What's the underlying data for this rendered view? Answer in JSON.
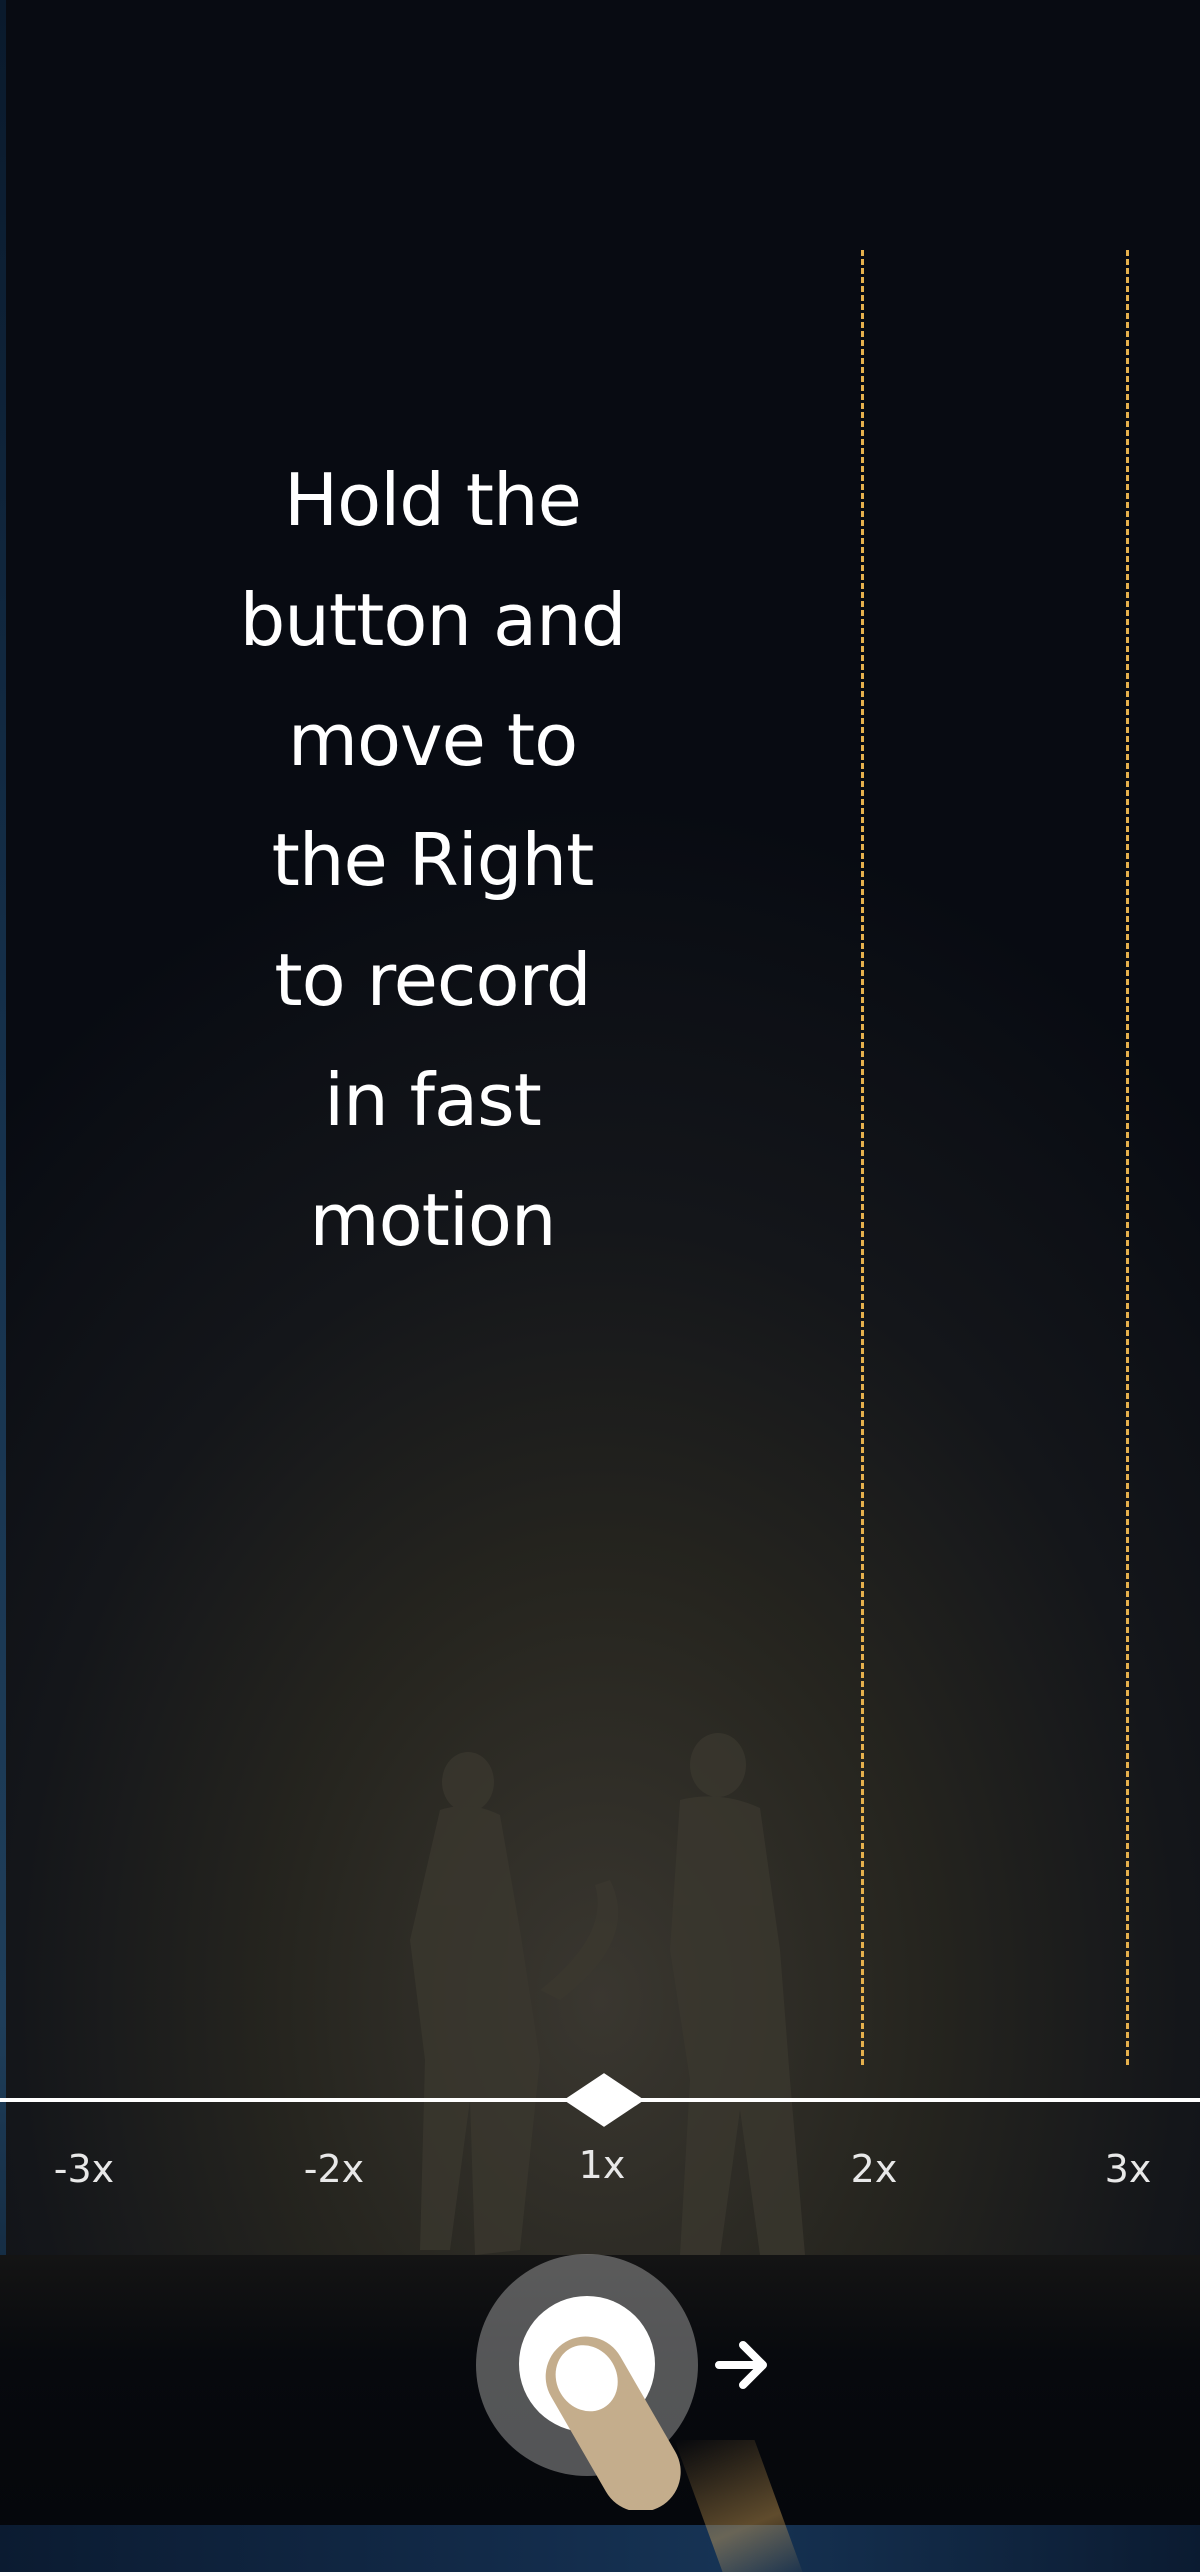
{
  "instruction": {
    "lines": [
      "Hold the",
      "button and",
      "move to",
      "the Right",
      "to record",
      "in fast",
      "motion"
    ]
  },
  "speed_scale": {
    "labels": [
      "-3x",
      "-2x",
      "1x",
      "2x",
      "3x"
    ],
    "selected": "1x",
    "marked_speeds": [
      "2x",
      "3x"
    ]
  },
  "icons": {
    "thumb": "slider-thumb-icon",
    "record": "record-button",
    "hand": "pointing-hand-icon",
    "arrow": "arrow-right-icon"
  },
  "colors": {
    "dashed_guide": "#e5b04d",
    "track": "#ffffff",
    "hand": "#c4ad8c",
    "text": "#ffffff"
  }
}
